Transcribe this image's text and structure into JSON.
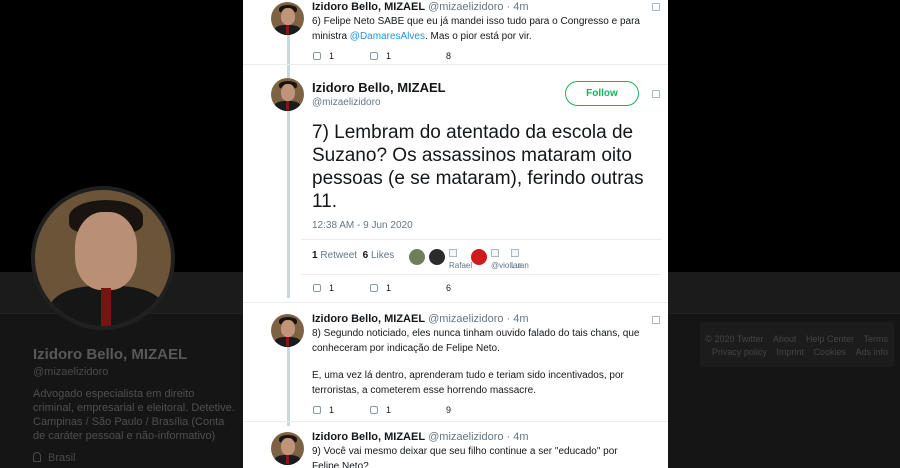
{
  "profile": {
    "name": "Izidoro Bello, MIZAEL",
    "handle": "@mizaelizidoro",
    "bio": "Advogado especialista em direito criminal, empresarial e eleitoral. Detetive. Campinas / São Paulo / Brasília (Conta de caráter pessoal e não-informativo)",
    "location": "Brasil"
  },
  "footer": {
    "row1": [
      "© 2020 Twitter",
      "About",
      "Help Center",
      "Terms"
    ],
    "row2": [
      "Privacy policy",
      "Imprint",
      "Cookies",
      "Ads info"
    ]
  },
  "tweet6": {
    "name": "Izidoro Bello, MIZAEL",
    "handle": "@mizaelizidoro",
    "dot": "·",
    "time": "4m",
    "text_before": "6) Felipe Neto SABE que eu já mandei isso tudo para o Congresso e para ministra ",
    "mention": "@DamaresAlves",
    "text_after": ". Mas o pior está por vir.",
    "replies": "1",
    "retweets": "1",
    "likes": "8"
  },
  "main_tweet": {
    "name": "Izidoro Bello, MIZAEL",
    "handle": "@mizaelizidoro",
    "follow_label": "Follow",
    "text": "7) Lembram do atentado da escola de Suzano? Os assassinos mataram oito pessoas (e se mataram), ferindo outras 11.",
    "date": "12:38 AM - 9 Jun 2020",
    "retweet_count": "1",
    "retweet_label": "Retweet",
    "like_count": "6",
    "like_label": "Likes",
    "liker_labels": [
      "Rafael",
      "@violian",
      "Luan"
    ],
    "replies": "1",
    "retweets": "1",
    "likes": "6"
  },
  "tweet8": {
    "name": "Izidoro Bello, MIZAEL",
    "handle": "@mizaelizidoro",
    "dot": "·",
    "time": "4m",
    "text1": "8) Segundo noticiado, eles nunca tinham ouvido falado do tais chans, que conheceram por indicação de Felipe Neto.",
    "text2": "E, uma vez lá dentro, aprenderam tudo e teriam sido incentivados, por terroristas, a cometerem esse horrendo massacre.",
    "replies": "1",
    "retweets": "1",
    "likes": "9"
  },
  "tweet9": {
    "name": "Izidoro Bello, MIZAEL",
    "handle": "@mizaelizidoro",
    "dot": "·",
    "time": "4m",
    "text": "9) Você vai mesmo deixar que seu filho continue a ser \"educado\" por Felipe Neto?"
  },
  "colors": {
    "follow_green": "#19b25b",
    "mention_blue": "#1b95e0",
    "thread_line": "#ccd6dd"
  }
}
